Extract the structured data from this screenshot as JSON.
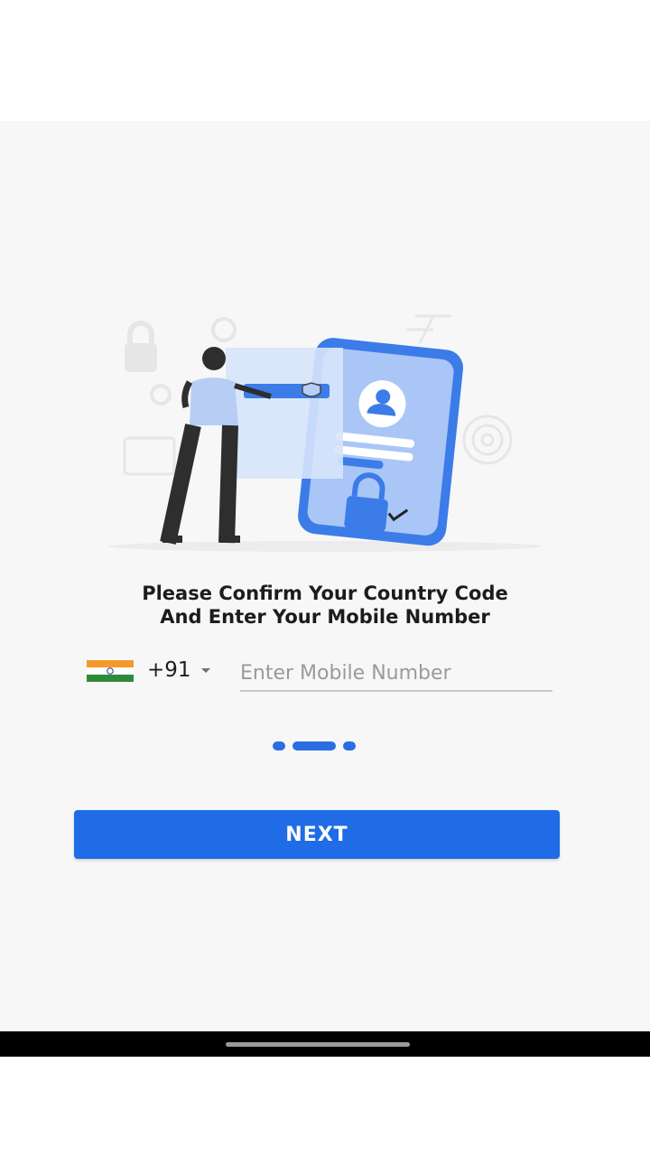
{
  "heading": {
    "line1": "Please Confirm Your Country Code",
    "line2": "And Enter Your Mobile Number"
  },
  "country": {
    "flag_icon": "india-flag-icon",
    "code": "+91"
  },
  "phone": {
    "value": "",
    "placeholder": "Enter Mobile Number"
  },
  "pager": {
    "pages": 3,
    "current_index": 1
  },
  "next_label": "NEXT",
  "colors": {
    "accent": "#1f6ce6",
    "background": "#f7f7f7",
    "text": "#1c1c1c",
    "placeholder": "#9a9a9a"
  }
}
